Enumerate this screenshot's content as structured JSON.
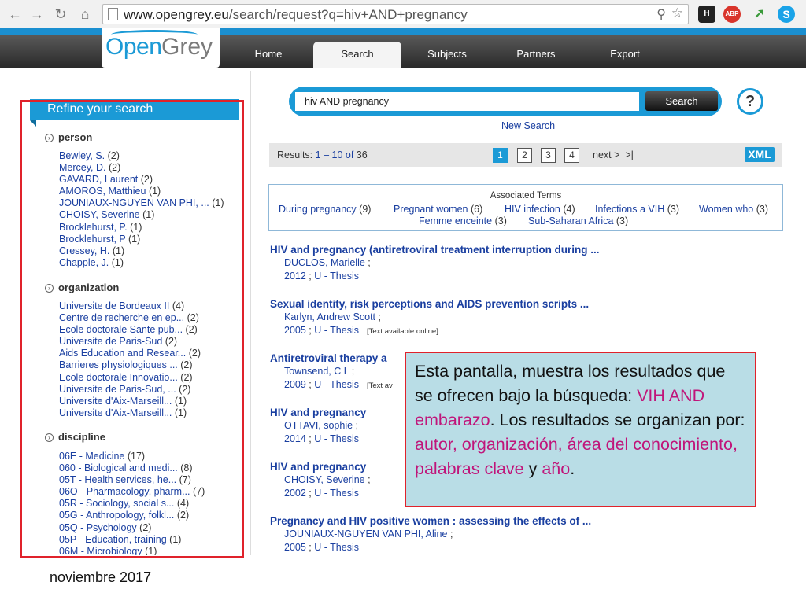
{
  "browser": {
    "url_domain": "www.opengrey.eu",
    "url_path": "/search/request?q=hiv+AND+pregnancy",
    "extensions": [
      "H",
      "ABP"
    ]
  },
  "site": {
    "logo_open": "Open",
    "logo_grey": "Grey",
    "nav": [
      "Home",
      "Search",
      "Subjects",
      "Partners",
      "Export"
    ]
  },
  "sidebar": {
    "title": "Refine your search",
    "facets": [
      {
        "name": "person",
        "items": [
          {
            "label": "Bewley, S.",
            "count": "(2)"
          },
          {
            "label": "Mercey, D.",
            "count": "(2)"
          },
          {
            "label": "GAVARD, Laurent",
            "count": "(2)"
          },
          {
            "label": "AMOROS, Matthieu",
            "count": "(1)"
          },
          {
            "label": "JOUNIAUX-NGUYEN VAN PHI, ...",
            "count": "(1)"
          },
          {
            "label": "CHOISY, Severine",
            "count": "(1)"
          },
          {
            "label": "Brocklehurst, P.",
            "count": "(1)"
          },
          {
            "label": "Brocklehurst, P",
            "count": "(1)"
          },
          {
            "label": "Cressey, H.",
            "count": "(1)"
          },
          {
            "label": "Chapple, J.",
            "count": "(1)"
          }
        ]
      },
      {
        "name": "organization",
        "items": [
          {
            "label": "Universite de Bordeaux II",
            "count": "(4)"
          },
          {
            "label": "Centre de recherche en ep...",
            "count": "(2)"
          },
          {
            "label": "Ecole doctorale Sante pub...",
            "count": "(2)"
          },
          {
            "label": "Universite de Paris-Sud",
            "count": "(2)"
          },
          {
            "label": "Aids Education and Resear...",
            "count": "(2)"
          },
          {
            "label": "Barrieres physiologiques ...",
            "count": "(2)"
          },
          {
            "label": "Ecole doctorale Innovatio...",
            "count": "(2)"
          },
          {
            "label": "Universite de Paris-Sud, ...",
            "count": "(2)"
          },
          {
            "label": "Universite d'Aix-Marseill...",
            "count": "(1)"
          },
          {
            "label": "Universite d'Aix-Marseill...",
            "count": "(1)"
          }
        ]
      },
      {
        "name": "discipline",
        "items": [
          {
            "label": "06E - Medicine",
            "count": "(17)"
          },
          {
            "label": "060 - Biological and medi...",
            "count": "(8)"
          },
          {
            "label": "05T - Health services, he...",
            "count": "(7)"
          },
          {
            "label": "06O - Pharmacology, pharm...",
            "count": "(7)"
          },
          {
            "label": "05R - Sociology, social s...",
            "count": "(4)"
          },
          {
            "label": "05G - Anthropology, folkl...",
            "count": "(2)"
          },
          {
            "label": "05Q - Psychology",
            "count": "(2)"
          },
          {
            "label": "05P - Education, training",
            "count": "(1)"
          },
          {
            "label": "06M - Microbiology",
            "count": "(1)"
          }
        ]
      }
    ]
  },
  "search": {
    "query": "hiv AND pregnancy",
    "button": "Search",
    "help": "?",
    "new_search": "New Search"
  },
  "results_bar": {
    "label": "Results:",
    "range": "1 – 10 of",
    "total": "36",
    "pages": [
      "1",
      "2",
      "3",
      "4"
    ],
    "next": "next >",
    "last": ">|",
    "xml": "XML"
  },
  "associated": {
    "title": "Associated Terms",
    "terms": [
      {
        "label": "During pregnancy",
        "count": "(9)"
      },
      {
        "label": "Pregnant women",
        "count": "(6)"
      },
      {
        "label": "HIV infection",
        "count": "(4)"
      },
      {
        "label": "Infections a VIH",
        "count": "(3)"
      },
      {
        "label": "Women who",
        "count": "(3)"
      },
      {
        "label": "Femme enceinte",
        "count": "(3)"
      },
      {
        "label": "Sub-Saharan Africa",
        "count": "(3)"
      }
    ]
  },
  "results": [
    {
      "title": "HIV and pregnancy (antiretroviral treatment interruption during ...",
      "author": "DUCLOS, Marielle",
      "year": "2012",
      "type": "U - Thesis",
      "note": ""
    },
    {
      "title": "Sexual identity, risk perceptions and AIDS prevention scripts ...",
      "author": "Karlyn, Andrew Scott",
      "year": "2005",
      "type": "U - Thesis",
      "note": "[Text available online]"
    },
    {
      "title": "Antiretroviral therapy a",
      "author": "Townsend, C L",
      "year": "2009",
      "type": "U - Thesis",
      "note": "[Text av"
    },
    {
      "title": "HIV and pregnancy",
      "author": "OTTAVI, sophie",
      "year": "2014",
      "type": "U - Thesis",
      "note": ""
    },
    {
      "title": "HIV and pregnancy",
      "author": "CHOISY, Severine",
      "year": "2002",
      "type": "U - Thesis",
      "note": ""
    },
    {
      "title": "Pregnancy and HIV positive women : assessing the effects of ...",
      "author": "JOUNIAUX-NGUYEN VAN PHI, Aline",
      "year": "2005",
      "type": "U - Thesis",
      "note": ""
    }
  ],
  "annotation": {
    "part1": "Esta pantalla, muestra los resultados que se ofrecen bajo la búsqueda: ",
    "hl1": "VIH AND embarazo",
    "part2": ". Los resultados se organizan por: ",
    "hl2": "autor, organización, área del conocimiento, palabras clave",
    "part3": " y ",
    "hl3": "año",
    "part4": "."
  },
  "footer": "noviembre 2017",
  "colors": {
    "accent": "#1b9ad6",
    "link": "#1a3fa0",
    "highlight_box": "#e0222b",
    "annotation_text": "#c0157a"
  }
}
